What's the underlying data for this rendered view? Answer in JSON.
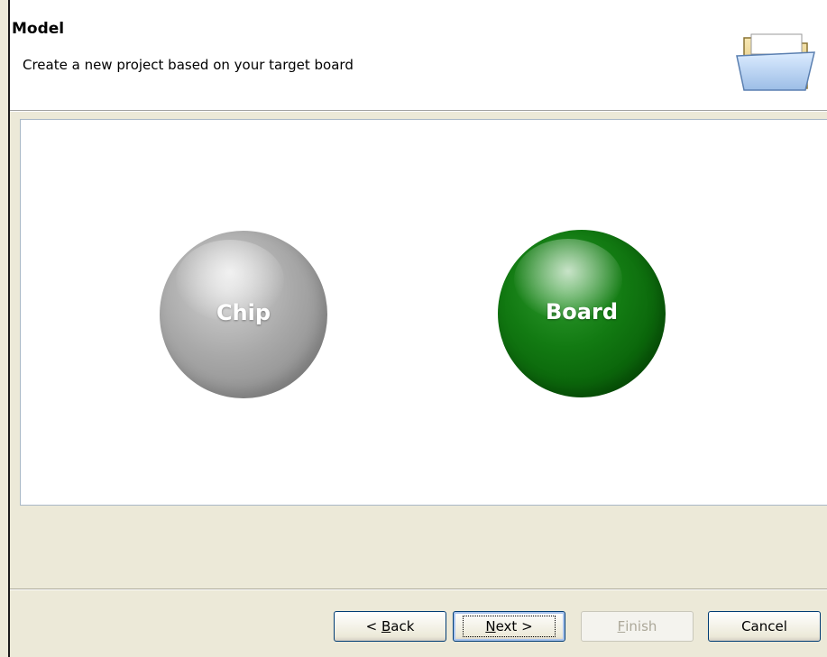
{
  "header": {
    "title": "Model",
    "description": "Create a new project based on your target board",
    "icon": "open-folder-icon"
  },
  "options": {
    "chip": {
      "label": "Chip",
      "color": "#a9a9a9"
    },
    "board": {
      "label": "Board",
      "color": "#127a12"
    }
  },
  "buttons": {
    "back": {
      "prefix": "< ",
      "mnemonic": "B",
      "rest": "ack"
    },
    "next": {
      "mnemonic": "N",
      "rest": "ext >"
    },
    "finish": {
      "mnemonic": "F",
      "rest": "inish",
      "enabled": false
    },
    "cancel": {
      "label": "Cancel"
    }
  }
}
